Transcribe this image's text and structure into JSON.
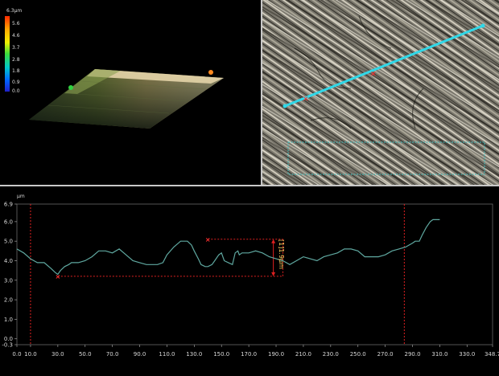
{
  "scale_bar": {
    "unit": "6.3μm",
    "ticks": [
      "5.6",
      "4.6",
      "3.7",
      "2.8",
      "1.8",
      "0.9",
      "0.0"
    ],
    "colors": [
      "#ff2a00",
      "#ffaa00",
      "#f0f000",
      "#3cdc3c",
      "#00c8c8",
      "#0064ff",
      "#2020c8"
    ]
  },
  "profile_annotation": {
    "label": "[1]1.9μm",
    "color": "#ffd060"
  },
  "chart_data": {
    "type": "line",
    "title": "",
    "xlabel": "",
    "ylabel": "μm",
    "xlim": [
      0.0,
      348.7
    ],
    "ylim": [
      -0.3,
      6.9
    ],
    "x_ticks": [
      "0.0",
      "10.0",
      "30.0",
      "50.0",
      "70.0",
      "90.0",
      "110.0",
      "130.0",
      "150.0",
      "170.0",
      "190.0",
      "210.0",
      "230.0",
      "250.0",
      "270.0",
      "290.0",
      "310.0",
      "330.0",
      "348.7"
    ],
    "y_ticks": [
      "6.9",
      "6.0",
      "5.0",
      "4.0",
      "3.0",
      "2.0",
      "1.0",
      "0.0",
      "-0.3"
    ],
    "x_tick_values": [
      0,
      10,
      30,
      50,
      70,
      90,
      110,
      130,
      150,
      170,
      190,
      210,
      230,
      250,
      270,
      290,
      310,
      330,
      348.7
    ],
    "y_tick_values": [
      6.9,
      6,
      5,
      4,
      3,
      2,
      1,
      0,
      -0.3
    ],
    "series": [
      {
        "color": "#5fa8a0",
        "x": [
          0,
          5,
          10,
          15,
          20,
          25,
          28,
          30,
          32,
          35,
          38,
          40,
          45,
          50,
          55,
          60,
          65,
          70,
          75,
          80,
          85,
          90,
          95,
          100,
          103,
          107,
          110,
          115,
          120,
          125,
          128,
          130,
          133,
          135,
          138,
          140,
          143,
          145,
          148,
          150,
          152,
          155,
          158,
          160,
          162,
          163,
          165,
          170,
          175,
          180,
          185,
          190,
          195,
          200,
          205,
          210,
          215,
          220,
          225,
          230,
          235,
          240,
          245,
          250,
          255,
          260,
          265,
          270,
          275,
          280,
          285,
          290,
          292,
          295,
          297,
          300,
          303,
          305,
          308,
          310
        ],
        "values": [
          4.6,
          4.4,
          4.1,
          3.9,
          3.9,
          3.6,
          3.4,
          3.3,
          3.5,
          3.7,
          3.8,
          3.9,
          3.9,
          4.0,
          4.2,
          4.5,
          4.5,
          4.4,
          4.6,
          4.3,
          4.0,
          3.9,
          3.8,
          3.8,
          3.8,
          3.9,
          4.3,
          4.7,
          5.0,
          5.0,
          4.8,
          4.5,
          4.1,
          3.8,
          3.7,
          3.7,
          3.8,
          4.0,
          4.3,
          4.4,
          4.0,
          3.9,
          3.8,
          4.4,
          4.5,
          4.3,
          4.4,
          4.4,
          4.5,
          4.4,
          4.2,
          4.1,
          4.0,
          3.8,
          4.0,
          4.2,
          4.1,
          4.0,
          4.2,
          4.3,
          4.4,
          4.6,
          4.6,
          4.5,
          4.2,
          4.2,
          4.2,
          4.3,
          4.5,
          4.6,
          4.7,
          4.9,
          5.0,
          5.0,
          5.3,
          5.7,
          6.0,
          6.1,
          6.1,
          6.1
        ]
      }
    ],
    "cursors_x": [
      10.0,
      284.0
    ],
    "measure_points": [
      [
        30.0,
        3.2
      ],
      [
        140.0,
        5.1
      ]
    ]
  }
}
